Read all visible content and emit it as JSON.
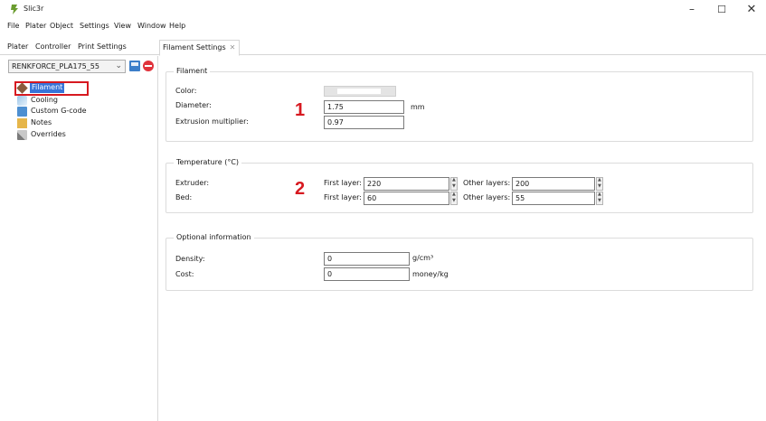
{
  "window": {
    "title": "Slic3r",
    "minimize": "–",
    "maximize": "☐",
    "close": "✕"
  },
  "menu": [
    "File",
    "Plater",
    "Object",
    "Settings",
    "View",
    "Window",
    "Help"
  ],
  "tabs": [
    {
      "label": "Plater"
    },
    {
      "label": "Controller"
    },
    {
      "label": "Print Settings"
    },
    {
      "label": "Filament Settings",
      "close": "✕"
    }
  ],
  "preset": {
    "value": "RENKFORCE_PLA175_55",
    "chevron": "⌄"
  },
  "sidebar": {
    "items": [
      {
        "label": "Filament",
        "icon": "filament-spool-icon"
      },
      {
        "label": "Cooling",
        "icon": "cooling-icon"
      },
      {
        "label": "Custom G-code",
        "icon": "gcode-icon"
      },
      {
        "label": "Notes",
        "icon": "notes-icon"
      },
      {
        "label": "Overrides",
        "icon": "wrench-icon"
      }
    ]
  },
  "filament_group": {
    "title": "Filament",
    "color_label": "Color:",
    "diameter_label": "Diameter:",
    "diameter_value": "1.75",
    "diameter_unit": "mm",
    "extrusion_label": "Extrusion multiplier:",
    "extrusion_value": "0.97"
  },
  "temperature_group": {
    "title": "Temperature (°C)",
    "extruder_label": "Extruder:",
    "bed_label": "Bed:",
    "first_layer_label": "First layer:",
    "other_layers_label": "Other layers:",
    "extruder_first": "220",
    "extruder_other": "200",
    "bed_first": "60",
    "bed_other": "55"
  },
  "optional_group": {
    "title": "Optional information",
    "density_label": "Density:",
    "density_value": "0",
    "density_unit": "g/cm³",
    "cost_label": "Cost:",
    "cost_value": "0",
    "cost_unit": "money/kg"
  },
  "annotations": [
    "1",
    "2"
  ],
  "colors": {
    "accent_red": "#d71920",
    "selection_blue": "#3874d8"
  }
}
